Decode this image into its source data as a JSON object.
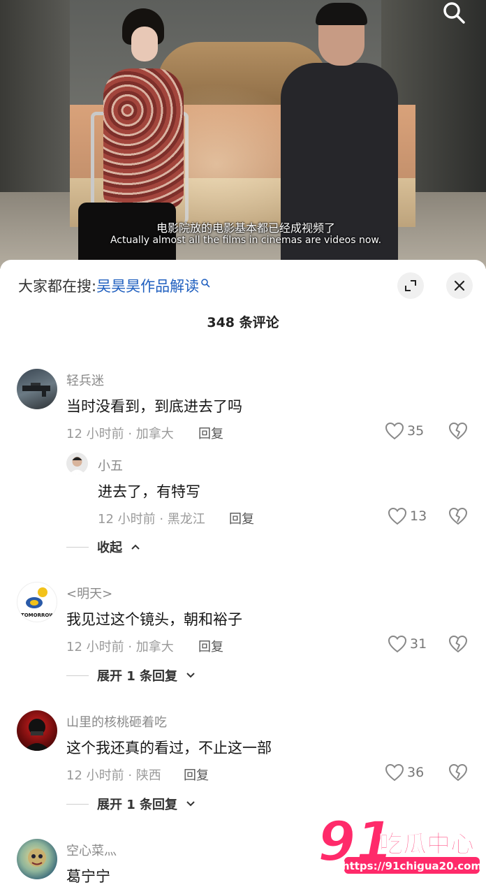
{
  "video": {
    "subtitle_cn": "电影院放的电影基本都已经成视频了",
    "subtitle_en": "Actually almost all the films in cinemas are videos now."
  },
  "search_bar": {
    "prefix": "大家都在搜:",
    "keyword": "吴昊昊作品解读"
  },
  "comment_count": "348 条评论",
  "comments": [
    {
      "name": "轻兵迷",
      "text": "当时没看到，到底进去了吗",
      "meta": "12 小时前 · 加拿大",
      "reply": "回复",
      "likes": "35",
      "replies": [
        {
          "name": "小五",
          "text": "进去了，有特写",
          "meta": "12 小时前 · 黑龙江",
          "reply": "回复",
          "likes": "13"
        }
      ],
      "expander": "收起"
    },
    {
      "name": "<明天>",
      "text": "我见过这个镜头，朝和裕子",
      "meta": "12 小时前 · 加拿大",
      "reply": "回复",
      "likes": "31",
      "expander": "展开 1 条回复"
    },
    {
      "name": "山里的核桃砸着吃",
      "text": "这个我还真的看过，不止这一部",
      "meta": "12 小时前 · 陕西",
      "reply": "回复",
      "likes": "36",
      "expander": "展开 1 条回复"
    },
    {
      "name": "空心菜灬",
      "text": "葛宁宁"
    }
  ],
  "watermark": {
    "number": "91",
    "text": "吃瓜中心",
    "url": "https://91chigua20.com"
  },
  "colors": {
    "keyword": "#1f5fbf",
    "watermark": "#ff2a6a"
  }
}
